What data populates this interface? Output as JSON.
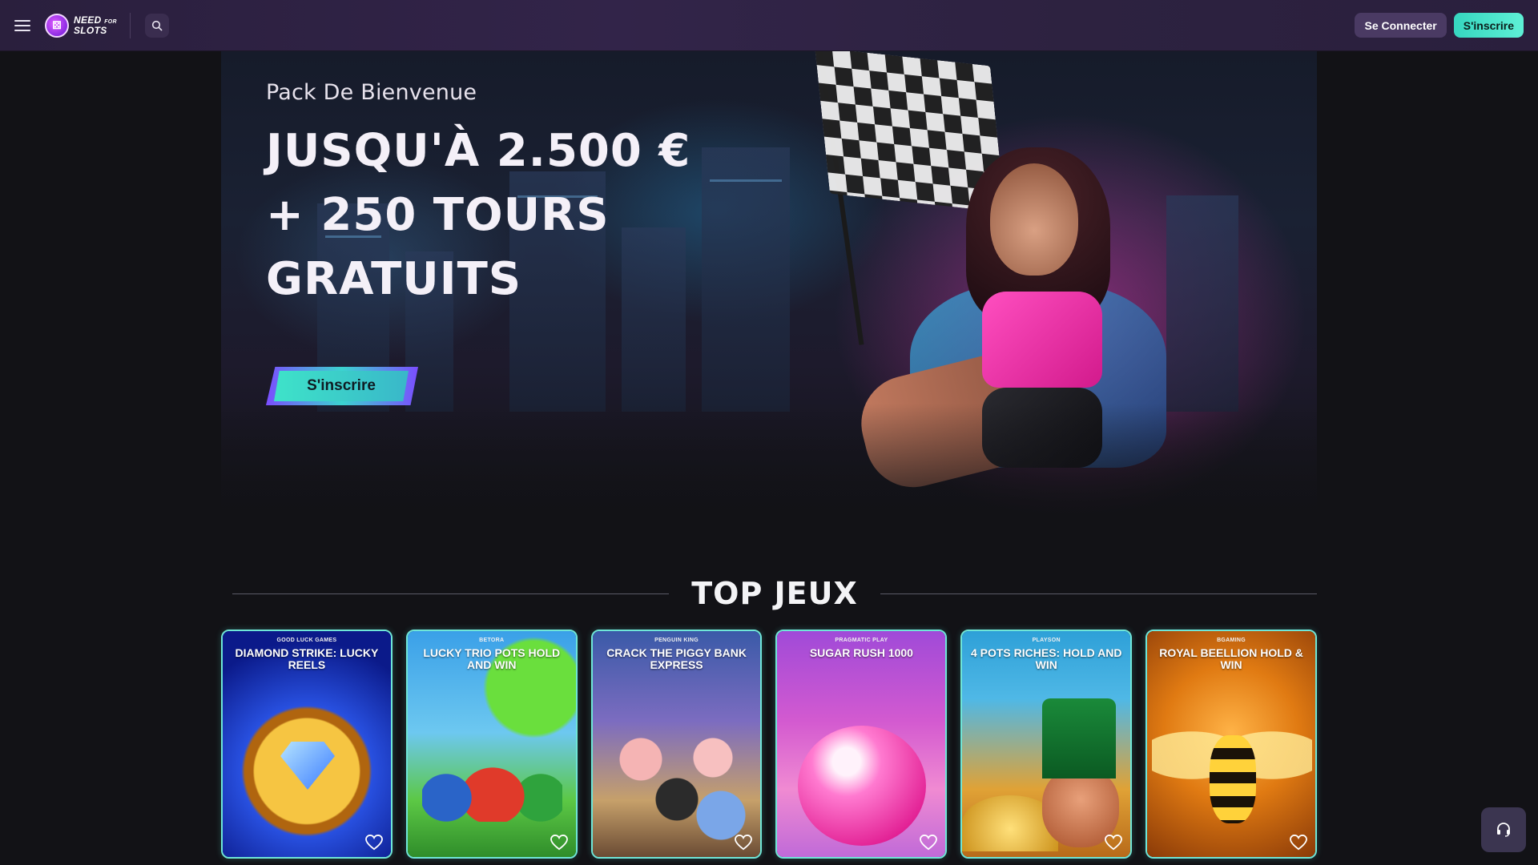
{
  "header": {
    "menu_icon": "hamburger-menu-icon",
    "logo": {
      "line1": "NEED",
      "line1_small": "FOR",
      "line2": "SLOTS"
    },
    "search_icon": "search-icon",
    "login_label": "Se Connecter",
    "signup_label": "S'inscrire"
  },
  "hero": {
    "subtitle": "Pack De Bienvenue",
    "title_line1": "JUSQU'À 2.500 €",
    "title_line2": "+ 250 TOURS",
    "title_line3": "GRATUITS",
    "cta_label": "S'inscrire"
  },
  "top_games": {
    "heading": "TOP JEUX",
    "games": [
      {
        "provider": "GOOD LUCK GAMES",
        "name": "DIAMOND STRIKE: LUCKY REELS"
      },
      {
        "provider": "BETORA",
        "name": "LUCKY TRIO POTS HOLD AND WIN"
      },
      {
        "provider": "PENGUIN KING",
        "name": "CRACK THE PIGGY BANK EXPRESS"
      },
      {
        "provider": "PRAGMATIC PLAY",
        "name": "SUGAR RUSH 1000"
      },
      {
        "provider": "PLAYSON",
        "name": "4 POTS RICHES: HOLD AND WIN"
      },
      {
        "provider": "BGAMING",
        "name": "ROYAL BEELLION HOLD & WIN"
      }
    ]
  },
  "support_icon": "headset-icon",
  "colors": {
    "accent_teal": "#3ee3c9",
    "header_purple": "#2d2240",
    "background": "#121216",
    "card_border": "#6fe6d8"
  }
}
